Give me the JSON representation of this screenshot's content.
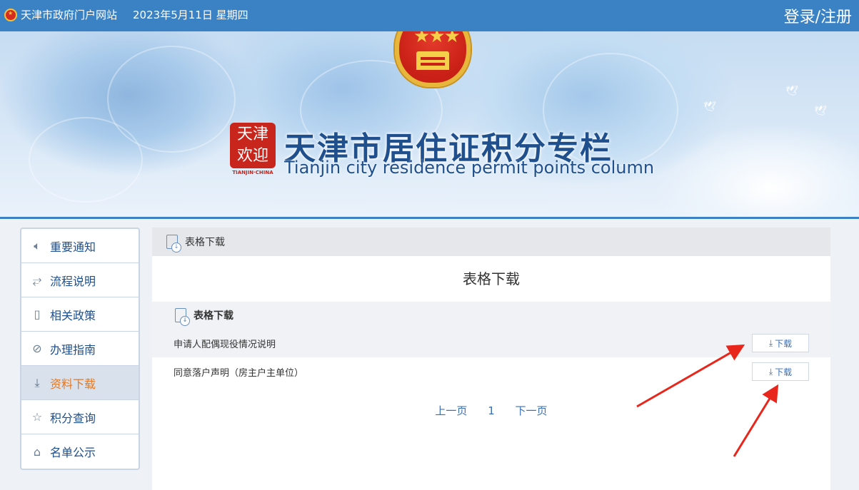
{
  "topbar": {
    "site_name": "天津市政府门户网站",
    "date": "2023年5月11日 星期四",
    "login": "登录/注册"
  },
  "banner": {
    "title_cn": "天津市居住证积分专栏",
    "title_en": "Tianjin city residence permit points column",
    "seal_text_1": "天津",
    "seal_text_2": "欢迎",
    "seal_sub": "TIANJIN·CHINA"
  },
  "sidebar": {
    "items": [
      {
        "label": "重要通知",
        "icon": "speaker-icon"
      },
      {
        "label": "流程说明",
        "icon": "flow-icon"
      },
      {
        "label": "相关政策",
        "icon": "book-icon"
      },
      {
        "label": "办理指南",
        "icon": "compass-icon"
      },
      {
        "label": "资料下载",
        "icon": "download-icon",
        "active": true
      },
      {
        "label": "积分查询",
        "icon": "star-icon"
      },
      {
        "label": "名单公示",
        "icon": "building-icon"
      }
    ]
  },
  "main": {
    "breadcrumb": "表格下载",
    "page_title": "表格下载",
    "section_title": "表格下载",
    "rows": [
      {
        "name": "申请人配偶现役情况说明",
        "button": "下载"
      },
      {
        "name": "同意落户声明（房主户主单位）",
        "button": "下载"
      }
    ],
    "pager": {
      "prev": "上一页",
      "current": "1",
      "next": "下一页"
    }
  },
  "colors": {
    "topbar": "#3b82c4",
    "accent": "#e07a2a",
    "link": "#3b6fb0",
    "arrow": "#e8261c"
  }
}
